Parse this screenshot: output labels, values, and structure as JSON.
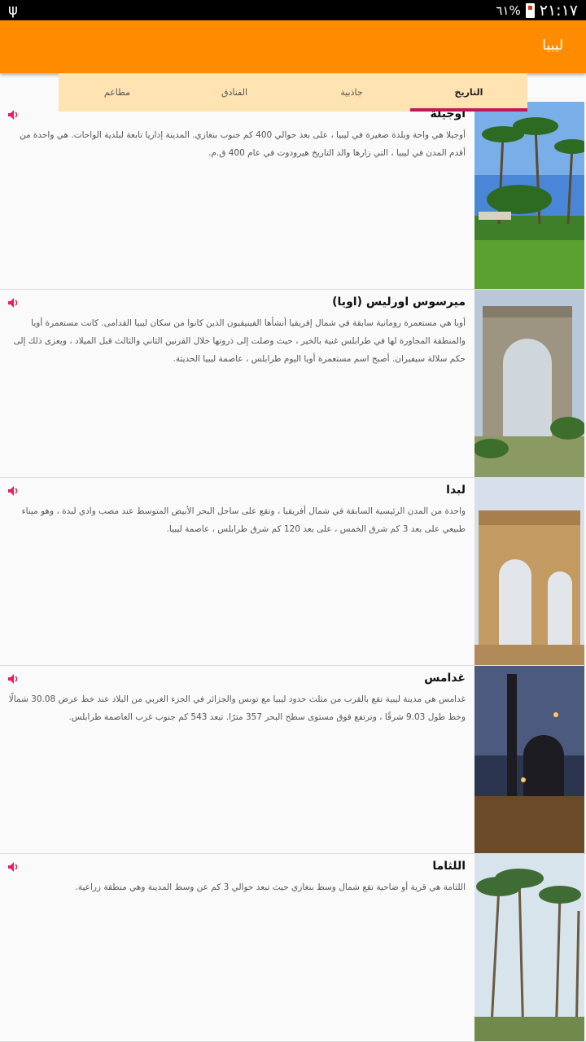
{
  "status_bar": {
    "usb_icon": "usb-icon",
    "battery": "٦١%",
    "time": "٢١:١٧"
  },
  "app_bar": {
    "title": "ليبيا"
  },
  "tabs": [
    {
      "label": "التاريخ",
      "active": true
    },
    {
      "label": "جاذبية",
      "active": false
    },
    {
      "label": "الفنادق",
      "active": false
    },
    {
      "label": "مطاعم",
      "active": false
    }
  ],
  "colors": {
    "app_bar": "#ff8c00",
    "tab_bar": "#ffe3b3",
    "tab_indicator": "#c2185b",
    "speaker": "#e91e63"
  },
  "items": [
    {
      "title": "اوجيلة",
      "description": "أوجيلا هي واحة وبلدة صغيرة في ليبيا ، على بعد حوالي 400 كم جنوب بنغازي. المدينة إداريا تابعة لبلدية الواحات. هي واحدة من أقدم المدن في ليبيا ، التي زارها والد التاريخ هيرودوت في عام 400 ق.م.",
      "speaker_icon": "speaker-icon",
      "image": "palm-oasis"
    },
    {
      "title": "ميرسوس اورليس (اويا)",
      "description": "أويا هي مستعمرة رومانية سابقة في شمال إفريقيا أنشأها الفينيقيون الذين كانوا من سكان ليبيا القدامى. كانت مستعمرة أويا والمنطقة المجاورة لها في طرابلس غنية بالخير ، حيث وصلت إلى ذروتها خلال القرنين الثاني والثالث قبل الميلاد ، ويعزى ذلك إلى حكم سلالة سيفيران. أصبح اسم مستعمرة أويا اليوم طرابلس ، عاصمة ليبيا الحديثة.",
      "speaker_icon": "speaker-icon",
      "image": "roman-arch"
    },
    {
      "title": "لبدا",
      "description": "واحدة من المدن الرئيسية السابقة في شمال أفريقيا ، وتقع على ساحل البحر الأبيض المتوسط عند مصب وادي لبدة ، وهو ميناء طبيعي على بعد 3 كم شرق الخمس ، على بعد 120 كم شرق طرابلس ، عاصمة ليبيا.",
      "speaker_icon": "speaker-icon",
      "image": "severan-arch"
    },
    {
      "title": "غدامس",
      "description": "غدامس هي مدينة ليبية تقع بالقرب من مثلث حدود ليبيا مع تونس والجزائر في الجزء الغربي من البلاد عند خط عرض 30.08 شمالًا وخط طول 9.03 شرقًا ، وترتفع فوق مستوى سطح البحر 357 مترًا. تبعد 543 كم جنوب غرب العاصمة طرابلس.",
      "speaker_icon": "speaker-icon",
      "image": "mosque-night"
    },
    {
      "title": "اللثاما",
      "description": "اللثامة هي قرية أو ضاحية تقع شمال وسط بنغازي حيث تبعد حوالي 3 كم عن وسط المدينة وهي منطقة زراعية.",
      "speaker_icon": "speaker-icon",
      "image": "palm-trees"
    }
  ]
}
